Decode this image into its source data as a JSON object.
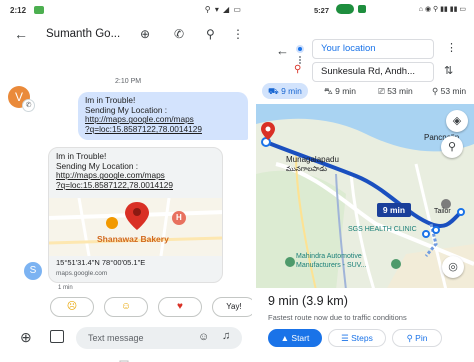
{
  "left": {
    "status_time": "2:12",
    "status_icons": "⚲ ▾ ◢ ▭",
    "header": {
      "back": "←",
      "title": "Sumanth Go...",
      "icons": [
        "⊕",
        "✆",
        "⚲",
        "⋮"
      ]
    },
    "date_label": "2:10 PM",
    "avatar_letter": "V",
    "outgoing": {
      "line1": "Im in Trouble!",
      "line2": "Sending My Location :",
      "link1": "http://maps.google.com/maps",
      "link2": "?q=loc:15.8587122,78.0014129"
    },
    "card": {
      "line1": "Im in Trouble!",
      "line2": "Sending My Location :",
      "link1": "http://maps.google.com/maps",
      "link2": "?q=loc:15.8587122,78.0014129",
      "place_label": "Shanawaz Bakery",
      "pin_letter": "H",
      "coords": "15°51'31.4\"N 78°00'05.1\"E",
      "domain": "maps.google.com"
    },
    "s_avatar": "S",
    "time_ago": "1 min",
    "reactions": [
      "☹",
      "☺",
      "♥",
      "Yay!"
    ],
    "compose": {
      "plus": "⊕",
      "placeholder": "Text message",
      "emoji": "☺",
      "mic": "♫"
    }
  },
  "right": {
    "status_time": "5:27",
    "status_icons": "⌂ ◉ ⚲ ▮▮ ▮▮ ▭",
    "back": "←",
    "from": "Your location",
    "to": "Sunkesula Rd, Andh...",
    "more": "⋮",
    "swap": "⇅",
    "modes": [
      {
        "icon": "⛟",
        "label": "9 min"
      },
      {
        "icon": "⛍",
        "label": "9 min"
      },
      {
        "icon": "⎚",
        "label": "53 min"
      },
      {
        "icon": "⚲",
        "label": "53 min"
      }
    ],
    "map": {
      "place1": "Munagalapadu",
      "place1_te": "మునగాలపాడు",
      "place2": "Pancnalin",
      "place3": "Tailor",
      "clinic": "SGS HEALTH CLINIC",
      "mahindra1": "Mahindra Automotive",
      "mahindra2": "Manufacturers - SUV...",
      "time_tag": "9 min"
    },
    "summary": {
      "duration": "9 min (3.9 km)",
      "note": "Fastest route now due to traffic conditions",
      "start": "▲ Start",
      "steps": "☰ Steps",
      "pin": "⚲ Pin"
    }
  },
  "colors": {
    "accent_blue": "#1a73e8",
    "route_blue": "#1a4fbf",
    "pin_red": "#d93025",
    "bubble_blue": "#d3e3fd",
    "avatar_orange": "#ea8a3a"
  }
}
